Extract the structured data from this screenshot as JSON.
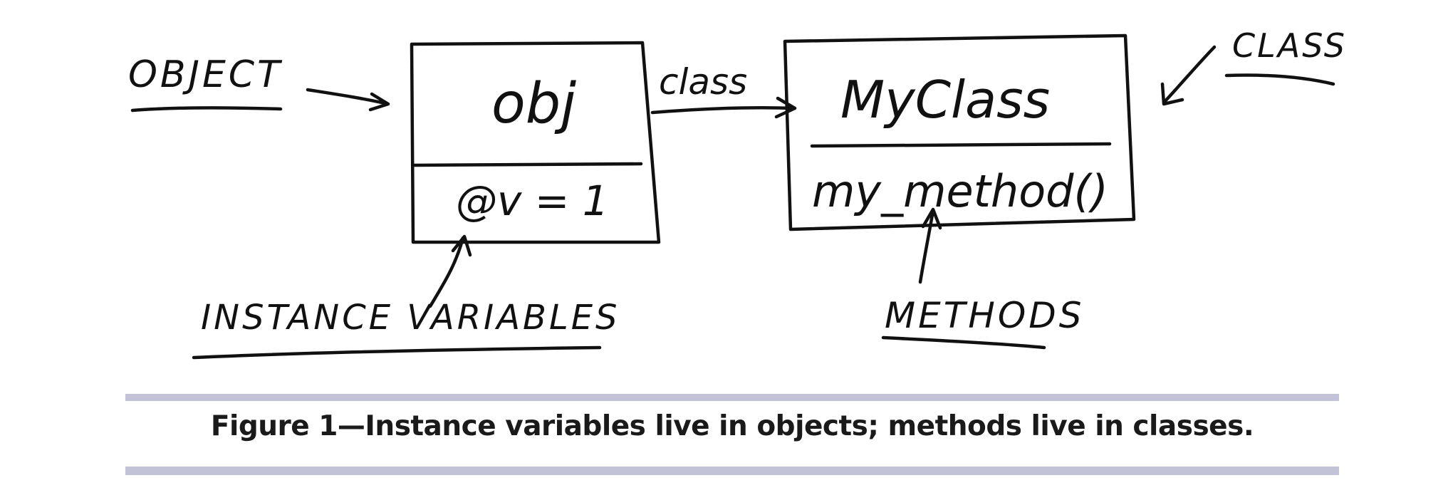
{
  "labels": {
    "object": "OBJECT",
    "class": "CLASS",
    "instance_variables": "INSTANCE VARIABLES",
    "methods": "METHODS",
    "class_arrow": "class"
  },
  "object_box": {
    "name": "obj",
    "variable": "@v = 1"
  },
  "class_box": {
    "name": "MyClass",
    "method": "my_method()"
  },
  "caption": "Figure 1—Instance variables live in objects; methods live in classes."
}
